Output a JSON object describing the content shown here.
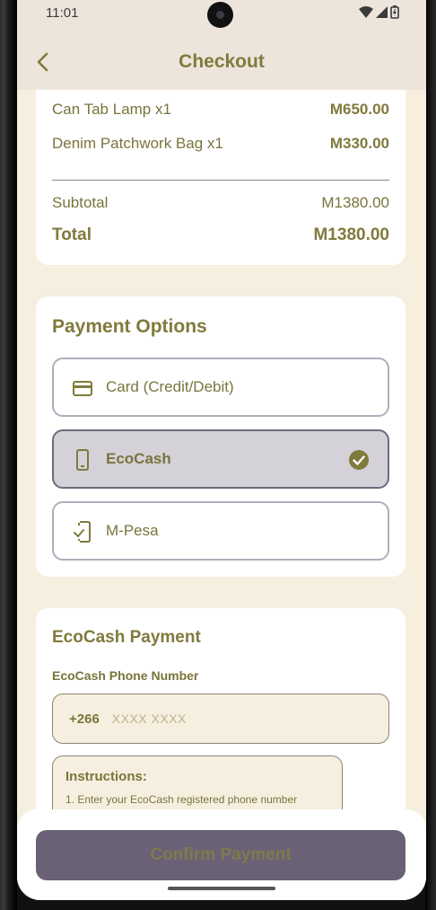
{
  "status_bar": {
    "time": "11:01"
  },
  "header": {
    "title": "Checkout"
  },
  "summary": {
    "items": [
      {
        "name": "Can Tab Lamp x1",
        "price": "M650.00"
      },
      {
        "name": "Denim Patchwork Bag x1",
        "price": "M330.00"
      }
    ],
    "subtotal_label": "Subtotal",
    "subtotal_value": "M1380.00",
    "total_label": "Total",
    "total_value": "M1380.00"
  },
  "payment_options": {
    "title": "Payment Options",
    "options": [
      {
        "label": "Card (Credit/Debit)",
        "icon": "credit-card-icon",
        "selected": false
      },
      {
        "label": "EcoCash",
        "icon": "smartphone-icon",
        "selected": true
      },
      {
        "label": "M-Pesa",
        "icon": "mobile-check-icon",
        "selected": false
      }
    ]
  },
  "ecocash": {
    "title": "EcoCash Payment",
    "phone_label": "EcoCash Phone Number",
    "prefix": "+266",
    "placeholder": "XXXX XXXX",
    "instructions_title": "Instructions:",
    "instructions_line1": "1. Enter your EcoCash registered phone number"
  },
  "confirm_button": {
    "label": "Confirm Payment"
  },
  "colors": {
    "accent": "#807a3d",
    "background": "#f6efe0",
    "selected_option": "#d4d1d8",
    "button": "#6a6176"
  }
}
